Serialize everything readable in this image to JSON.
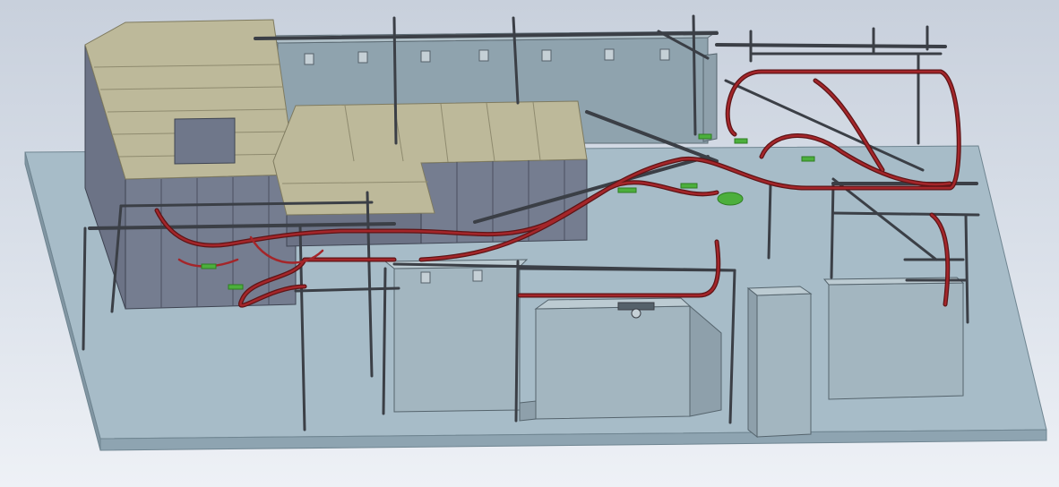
{
  "viewport": {
    "background_top": "#c8d0dc",
    "background_bottom": "#eef1f6"
  },
  "colors": {
    "floor_top": "#a7bcc8",
    "floor_side": "#8ea4b1",
    "booth_front": "#757d90",
    "booth_side": "#5f6679",
    "booth_roof": "#bdb99a",
    "roof_line": "#8f8b6f",
    "box_front": "#a3b6c0",
    "box_top": "#bccbd2",
    "box_side": "#8ea0ab",
    "steel": "#3b3f46",
    "steel_light": "#6b7078",
    "conveyor_track": "#a4262a",
    "conveyor_dark": "#5e1416",
    "green_fitting": "#4caf3c",
    "tank": "#9aa6ad"
  },
  "icons": {
    "drive_unit": "drive-unit-icon",
    "take_up": "take-up-icon"
  }
}
